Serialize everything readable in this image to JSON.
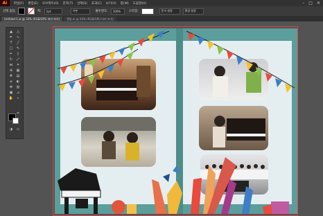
{
  "app": {
    "logo": "Ai",
    "accent": "#ff9a00"
  },
  "menu": {
    "items": [
      "파일(F)",
      "편집(E)",
      "오브젝트(O)",
      "문자(T)",
      "선택(S)",
      "효과(C)",
      "보기(V)",
      "창(W)",
      "도움말(H)"
    ]
  },
  "window_controls": {
    "minimize": "–",
    "maximize": "□",
    "close": "✕"
  },
  "control_bar": {
    "selection_label": "선택 없음",
    "stroke_label": "획:",
    "stroke_weight": "1pt",
    "brush_label": "기본",
    "opacity_label": "불투명도:",
    "opacity_value": "100%",
    "style_label": "스타일:",
    "doc_settings": "문서 설정",
    "prefs": "환경 설정"
  },
  "tabs": [
    {
      "label": "Untitled-1.ai @ 33% (RGB/GPU 미리 보기)",
      "active": true
    },
    {
      "label": "앨범.ai @ 50% (RGB/GPU 미리 보기)",
      "active": false
    }
  ],
  "toolbar": {
    "tools": [
      "selection-tool",
      "direct-selection-tool",
      "pen-tool",
      "curvature-tool",
      "type-tool",
      "line-tool",
      "rectangle-tool",
      "paintbrush-tool",
      "pencil-tool",
      "eraser-tool",
      "rotate-tool",
      "scale-tool",
      "width-tool",
      "free-transform-tool",
      "shape-builder-tool",
      "perspective-tool",
      "mesh-tool",
      "gradient-tool",
      "eyedropper-tool",
      "blend-tool",
      "symbol-sprayer-tool",
      "column-graph-tool",
      "artboard-tool",
      "slice-tool",
      "hand-tool",
      "zoom-tool"
    ]
  },
  "colors": {
    "canvas_bg": "#5b9e9b",
    "page_bg": "#e4eef0",
    "fill": "#000000",
    "stroke": "#ffffff"
  },
  "photos": [
    {
      "name": "piano-room-photo"
    },
    {
      "name": "children-piano-photo"
    },
    {
      "name": "violin-duo-photo"
    },
    {
      "name": "piano-lesson-photo"
    },
    {
      "name": "concert-group-photo"
    }
  ]
}
